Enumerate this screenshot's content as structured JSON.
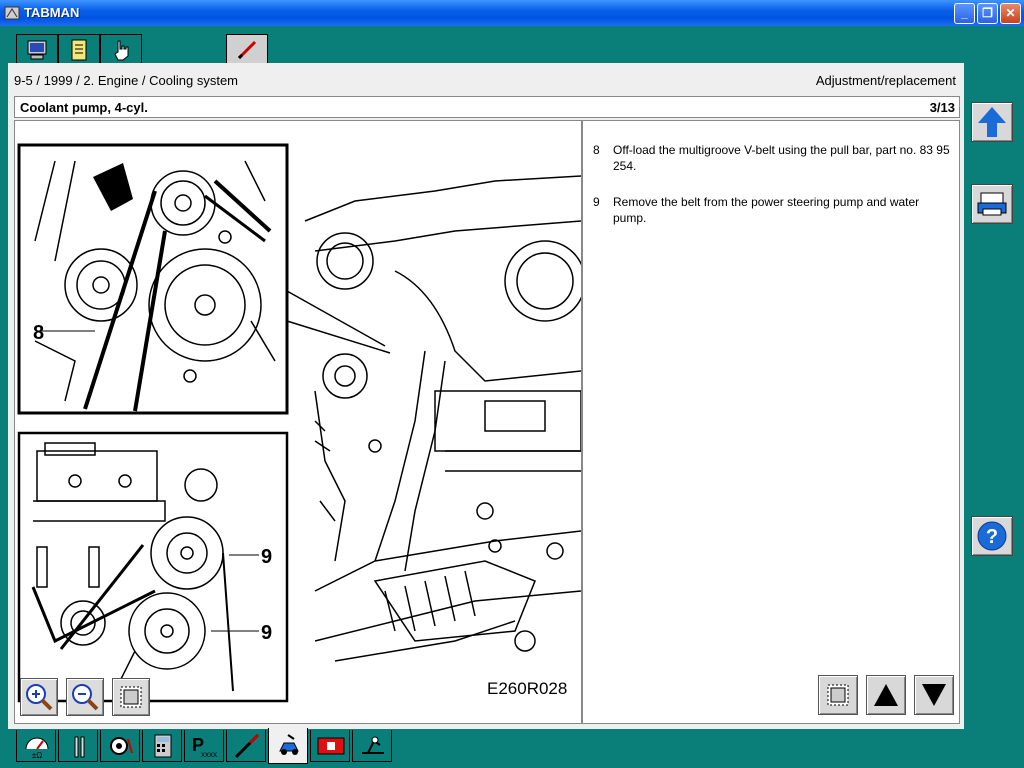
{
  "window": {
    "title": "TABMAN"
  },
  "breadcrumb": "9-5 / 1999 / 2. Engine / Cooling system",
  "doc_type": "Adjustment/replacement",
  "page": {
    "heading": "Coolant pump, 4-cyl.",
    "page_indicator": "3/13"
  },
  "instructions": [
    {
      "num": "8",
      "text": "Off-load the multigroove V-belt using the pull bar, part no. 83 95 254."
    },
    {
      "num": "9",
      "text": "Remove the belt from the power steering pump and water pump."
    }
  ],
  "illustration": {
    "figure_code": "E260R028",
    "callouts": [
      "8",
      "9",
      "9"
    ]
  },
  "top_tabs": [
    "computer-icon",
    "document-icon",
    "hand-pointer-icon",
    "pen-icon"
  ],
  "bottom_tabs": [
    "meter-icon",
    "wrench-icon",
    "gear-settings-icon",
    "calculator-icon",
    "p-xxxx-icon",
    "probe-icon",
    "car-diagnostic-icon",
    "red-card-icon",
    "tool-kit-icon"
  ],
  "colors": {
    "frame": "#0a7f7a",
    "titlebar": "#0054e3",
    "accent_blue": "#1a6ad8"
  }
}
